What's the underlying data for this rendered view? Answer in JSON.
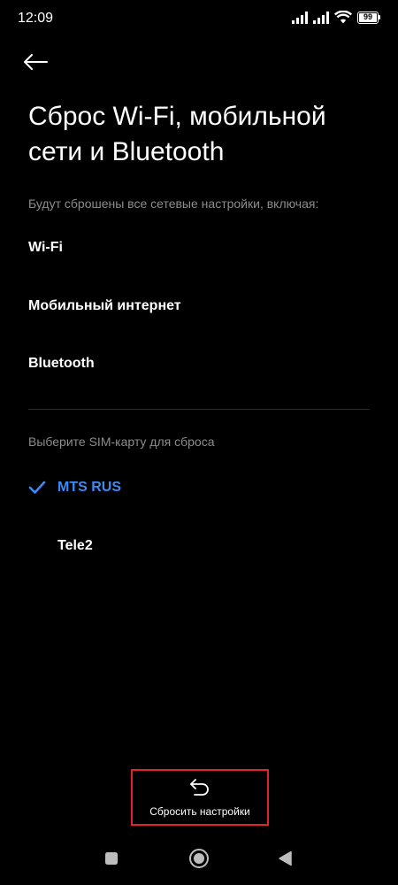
{
  "status_bar": {
    "time": "12:09",
    "battery": "99",
    "icons": [
      "signal-icon",
      "signal-icon",
      "wifi-icon",
      "battery-icon"
    ]
  },
  "header": {
    "back_icon": "back-arrow-icon",
    "title": "Сброс Wi-Fi, мобильной сети и Bluetooth"
  },
  "reset_info": {
    "caption": "Будут сброшены все сетевые настройки, включая:",
    "items": [
      "Wi-Fi",
      "Мобильный интернет",
      "Bluetooth"
    ]
  },
  "sim_selection": {
    "caption": "Выберите SIM-карту для сброса",
    "options": [
      {
        "label": "MTS RUS",
        "selected": true
      },
      {
        "label": "Tele2",
        "selected": false
      }
    ]
  },
  "reset_button": {
    "label": "Сбросить настройки",
    "icon": "undo-icon"
  },
  "nav_bar": {
    "icons": [
      "recents-square-icon",
      "home-circle-icon",
      "back-triangle-icon"
    ]
  },
  "colors": {
    "background": "#000000",
    "text": "#ffffff",
    "caption": "#8c8c8c",
    "accent": "#3d8af7",
    "highlight_border": "#e0242a",
    "divider": "#2a2a2a"
  }
}
